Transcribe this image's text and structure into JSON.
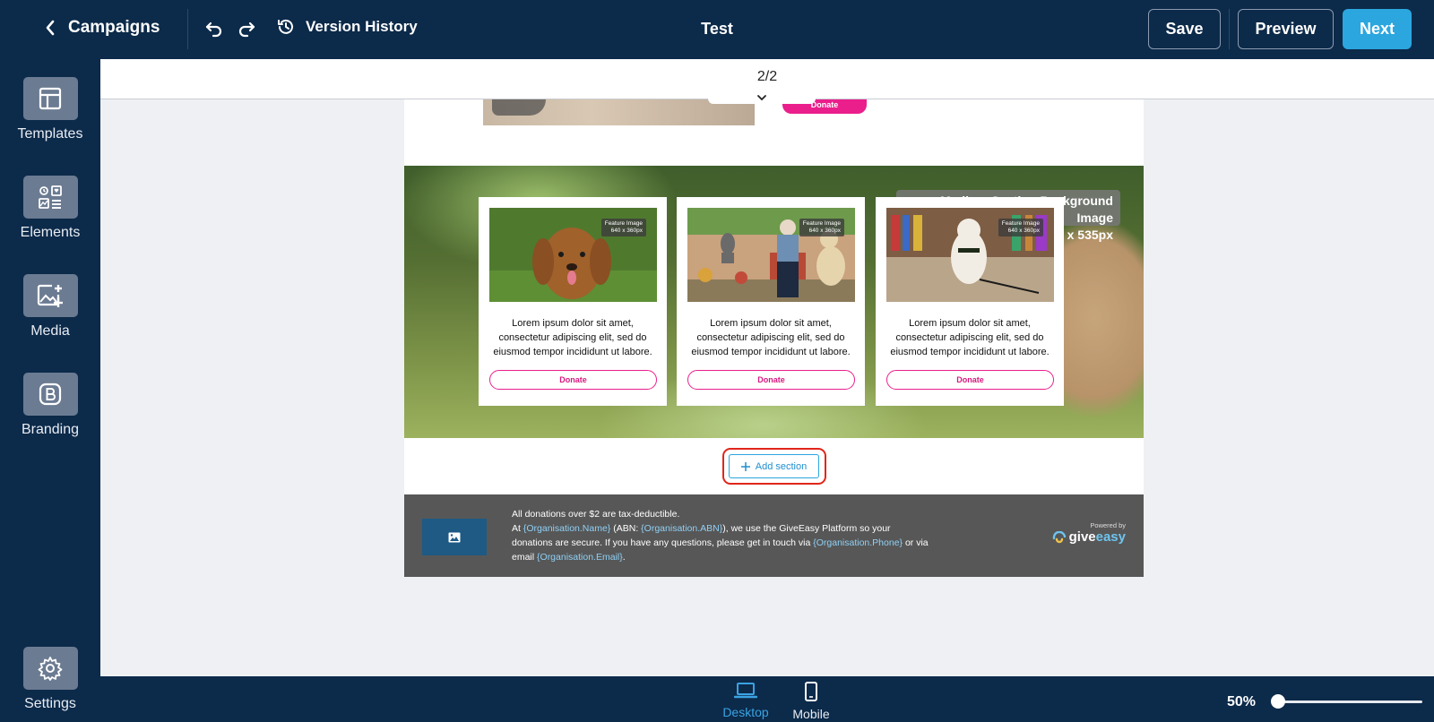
{
  "header": {
    "back_label": "Campaigns",
    "version_history_label": "Version History",
    "title": "Test",
    "save_label": "Save",
    "preview_label": "Preview",
    "next_label": "Next"
  },
  "sidebar": {
    "items": [
      {
        "label": "Templates",
        "icon": "templates-icon"
      },
      {
        "label": "Elements",
        "icon": "elements-icon"
      },
      {
        "label": "Media",
        "icon": "media-add-icon"
      },
      {
        "label": "Branding",
        "icon": "branding-icon"
      }
    ],
    "settings_label": "Settings"
  },
  "canvas": {
    "page_indicator": "2/2",
    "top_donate_label": "Donate",
    "hero_tag_line1": "Medium Section Background Image",
    "hero_tag_line2": "x 535px",
    "cards": [
      {
        "feature_line1": "Feature Image",
        "feature_line2": "640 x 360px",
        "text": "Lorem ipsum dolor sit amet, consectetur adipiscing elit, sed do eiusmod tempor incididunt ut labore.",
        "button": "Donate"
      },
      {
        "feature_line1": "Feature Image",
        "feature_line2": "640 x 360px",
        "text": "Lorem ipsum dolor sit amet, consectetur adipiscing elit, sed do eiusmod tempor incididunt ut labore.",
        "button": "Donate"
      },
      {
        "feature_line1": "Feature Image",
        "feature_line2": "640 x 360px",
        "text": "Lorem ipsum dolor sit amet, consectetur adipiscing elit, sed do eiusmod tempor incididunt ut labore.",
        "button": "Donate"
      }
    ],
    "add_section_label": "Add section",
    "footer": {
      "line1": "All donations over $2 are tax-deductible.",
      "at": "At ",
      "org_name": "{Organisation.Name}",
      "abn_prefix": " (ABN: ",
      "org_abn": "{Organisation.ABN}",
      "abn_suffix": "), we use the GiveEasy Platform so your donations are secure. If you have any questions, please get in touch via ",
      "org_phone": "{Organisation.Phone}",
      "email_prefix": " or via email ",
      "org_email": "{Organisation.Email}",
      "end": ".",
      "powered_by": "Powered by",
      "logo_give": "give",
      "logo_easy": "easy"
    }
  },
  "bottom": {
    "desktop_label": "Desktop",
    "mobile_label": "Mobile",
    "zoom_label": "50%",
    "zoom_fraction": 0.0
  },
  "colors": {
    "chrome": "#0c2a4a",
    "accent": "#2ba6df",
    "donate": "#ea1f8c",
    "highlight_ring": "#e1251b"
  }
}
